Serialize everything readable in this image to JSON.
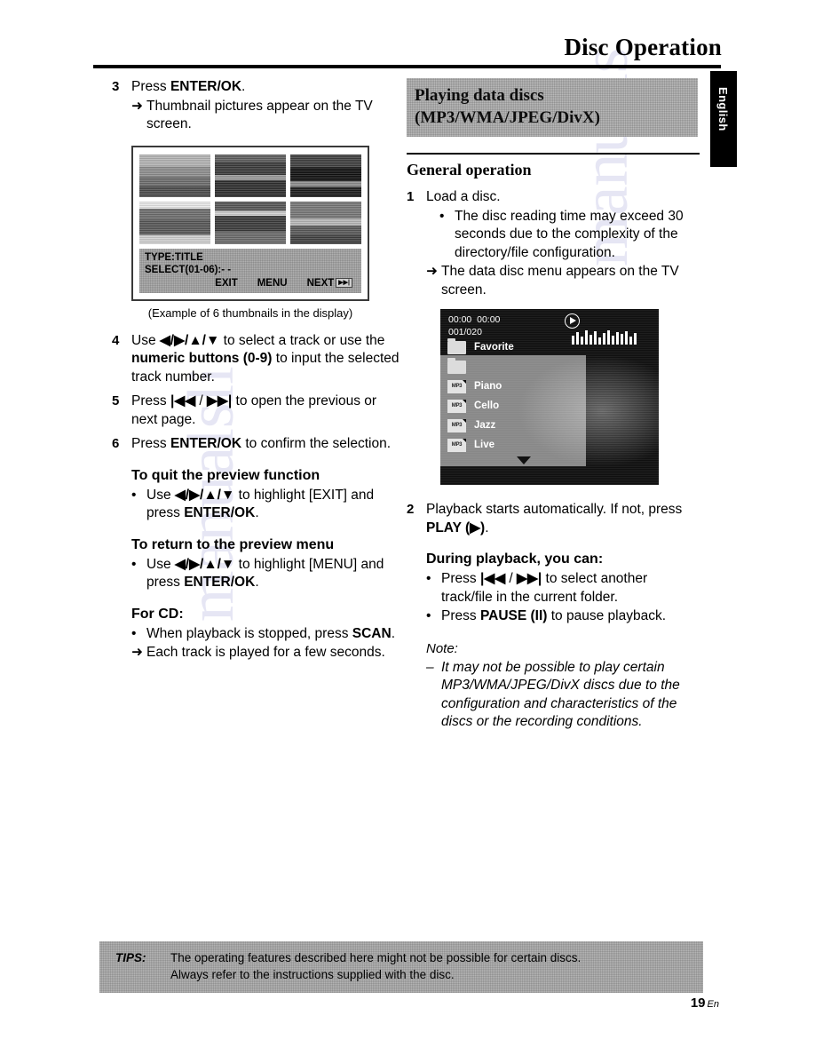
{
  "header": {
    "title": "Disc Operation",
    "language_tab": "English"
  },
  "left_column": {
    "step3": {
      "num": "3",
      "text_prefix": "Press ",
      "text_bold": "ENTER/OK",
      "text_suffix": ".",
      "result_arrow": "➜",
      "result": "Thumbnail pictures appear on the TV screen."
    },
    "thumbnail_figure": {
      "osd_type": "TYPE:TITLE",
      "osd_select": "SELECT(01-06):- -",
      "osd_exit": "EXIT",
      "osd_menu": "MENU",
      "osd_next": "NEXT",
      "osd_next_glyph": "▶▶|",
      "caption": "(Example of 6 thumbnails in the display)",
      "thumbs": [
        "thumb-1",
        "thumb-2",
        "thumb-3",
        "thumb-4",
        "thumb-5",
        "thumb-6"
      ]
    },
    "step4": {
      "num": "4",
      "part1": "Use ",
      "arrows": "◀/▶/▲/▼",
      "part2": " to select a track or use the ",
      "bold": "numeric buttons (0-9)",
      "part3": " to input the selected track number."
    },
    "step5": {
      "num": "5",
      "part1": "Press ",
      "prev_glyph": "|◀◀",
      "sep": " / ",
      "next_glyph": "▶▶|",
      "part2": " to open the previous or next page."
    },
    "step6": {
      "num": "6",
      "part1": "Press ",
      "bold": "ENTER/OK",
      "part2": " to confirm the selection."
    },
    "quit_preview": {
      "heading": "To quit the preview function",
      "bullet": "•",
      "part1": "Use ",
      "arrows": "◀/▶/▲/▼",
      "part2": " to highlight [EXIT] and press ",
      "bold": "ENTER/OK",
      "part3": "."
    },
    "return_preview": {
      "heading": "To return to the preview menu",
      "bullet": "•",
      "part1": "Use ",
      "arrows": "◀/▶/▲/▼",
      "part2": " to highlight [MENU] and press ",
      "bold": "ENTER/OK",
      "part3": "."
    },
    "for_cd": {
      "heading": "For CD:",
      "bullet": "•",
      "part1": "When playback is stopped, press ",
      "bold": "SCAN",
      "part2": ".",
      "result_arrow": "➜",
      "result": "Each track is played for a few seconds."
    }
  },
  "right_column": {
    "section_band": "Playing data discs (MP3/WMA/JPEG/DivX)",
    "general_operation": "General operation",
    "step1": {
      "num": "1",
      "text": "Load a disc.",
      "bullet": "•",
      "bullet_text": "The disc reading time may exceed 30 seconds due to the complexity of the directory/file configuration.",
      "result_arrow": "➜",
      "result": "The data disc menu appears on the TV screen."
    },
    "tv_menu": {
      "time_elapsed": "00:00",
      "time_total": "00:00",
      "track_counter": "001/020",
      "play_icon": "play-icon",
      "meter_bars": [
        10,
        14,
        9,
        16,
        11,
        15,
        8,
        13,
        16,
        10,
        14,
        12,
        15,
        9,
        13
      ],
      "items": [
        {
          "icon": "folder",
          "label": "Favorite"
        },
        {
          "icon": "folder",
          "label": ""
        },
        {
          "icon": "mp3",
          "icon_text": "MP3",
          "label": "Piano"
        },
        {
          "icon": "mp3",
          "icon_text": "MP3",
          "label": "Cello"
        },
        {
          "icon": "mp3",
          "icon_text": "MP3",
          "label": "Jazz"
        },
        {
          "icon": "mp3",
          "icon_text": "MP3",
          "label": "Live"
        }
      ],
      "scroll_arrow": "scroll-down-arrow"
    },
    "step2": {
      "num": "2",
      "part1": "Playback starts automatically. If not, press ",
      "bold": "PLAY (▶)",
      "part2": "."
    },
    "during_playback": {
      "heading": "During playback, you can:",
      "bullet": "•",
      "b1_part1": "Press ",
      "b1_prev": "|◀◀",
      "b1_sep": " / ",
      "b1_next": "▶▶|",
      "b1_part2": " to select another track/file in the current folder.",
      "b2_part1": "Press ",
      "b2_bold": "PAUSE (II)",
      "b2_part2": " to pause playback."
    },
    "note": {
      "heading": "Note:",
      "dash": "–",
      "text": "It may not be possible to play certain MP3/WMA/JPEG/DivX discs due to the configuration and characteristics of the discs or the recording conditions."
    }
  },
  "footer": {
    "tips_label": "TIPS:",
    "tips_line1": "The operating features described here might not be possible for certain discs.",
    "tips_line2": "Always refer to the instructions supplied with the disc.",
    "page_number": "19",
    "page_lang": "En"
  },
  "watermark": {
    "text1": "manualsli",
    "text2": "manuals"
  },
  "colors": {
    "band_grey": "#b9b9b9",
    "tips_grey": "#b4b4b4",
    "ink": "#000000",
    "tv_bg": "#0b0b0b"
  }
}
